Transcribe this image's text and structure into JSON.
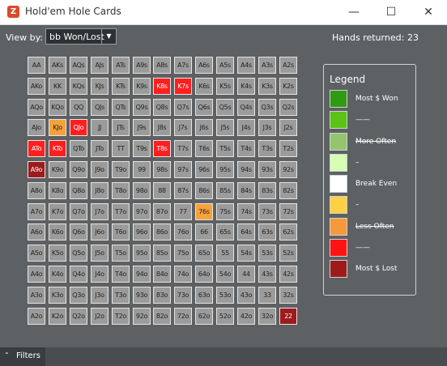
{
  "window": {
    "title": "Hold'em Hole Cards",
    "minimize_glyph": "—",
    "maximize_glyph": "☐",
    "close_glyph": "✕",
    "app_icon": "Z"
  },
  "toolbar": {
    "view_by_label": "View by:",
    "view_by_value": "bb Won/Lost",
    "hands_returned_label": "Hands returned:",
    "hands_returned_value": "23"
  },
  "colors": {
    "neutral": "#9b9b9b",
    "lost_red": "#ff1f1f",
    "dark_red": "#9e1b1b",
    "orange": "#f5a23b"
  },
  "grid": {
    "rows": [
      [
        "AA",
        "AKs",
        "AQs",
        "AJs",
        "ATs",
        "A9s",
        "A8s",
        "A7s",
        "A6s",
        "A5s",
        "A4s",
        "A3s",
        "A2s"
      ],
      [
        "AKo",
        "KK",
        "KQs",
        "KJs",
        "KTs",
        "K9s",
        "K8s",
        "K7s",
        "K6s",
        "K5s",
        "K4s",
        "K3s",
        "K2s"
      ],
      [
        "AQo",
        "KQo",
        "QQ",
        "QJs",
        "QTs",
        "Q9s",
        "Q8s",
        "Q7s",
        "Q6s",
        "Q5s",
        "Q4s",
        "Q3s",
        "Q2s"
      ],
      [
        "AJo",
        "KJo",
        "QJo",
        "JJ",
        "JTs",
        "J9s",
        "J8s",
        "J7s",
        "J6s",
        "J5s",
        "J4s",
        "J3s",
        "J2s"
      ],
      [
        "ATo",
        "KTo",
        "QTo",
        "JTo",
        "TT",
        "T9s",
        "T8s",
        "T7s",
        "T6s",
        "T5s",
        "T4s",
        "T3s",
        "T2s"
      ],
      [
        "A9o",
        "K9o",
        "Q9o",
        "J9o",
        "T9o",
        "99",
        "98s",
        "97s",
        "96s",
        "95s",
        "94s",
        "93s",
        "92s"
      ],
      [
        "A8o",
        "K8o",
        "Q8o",
        "J8o",
        "T8o",
        "98o",
        "88",
        "87s",
        "86s",
        "85s",
        "84s",
        "83s",
        "82s"
      ],
      [
        "A7o",
        "K7o",
        "Q7o",
        "J7o",
        "T7o",
        "97o",
        "87o",
        "77",
        "76s",
        "75s",
        "74s",
        "73s",
        "72s"
      ],
      [
        "A6o",
        "K6o",
        "Q6o",
        "J6o",
        "T6o",
        "96o",
        "86o",
        "76o",
        "66",
        "65s",
        "64s",
        "63s",
        "62s"
      ],
      [
        "A5o",
        "K5o",
        "Q5o",
        "J5o",
        "T5o",
        "95o",
        "85o",
        "75o",
        "65o",
        "55",
        "54s",
        "53s",
        "52s"
      ],
      [
        "A4o",
        "K4o",
        "Q4o",
        "J4o",
        "T4o",
        "94o",
        "84o",
        "74o",
        "64o",
        "54o",
        "44",
        "43s",
        "42s"
      ],
      [
        "A3o",
        "K3o",
        "Q3o",
        "J3o",
        "T3o",
        "93o",
        "83o",
        "73o",
        "63o",
        "53o",
        "43o",
        "33",
        "32s"
      ],
      [
        "A2o",
        "K2o",
        "Q2o",
        "J2o",
        "T2o",
        "92o",
        "82o",
        "72o",
        "62o",
        "52o",
        "42o",
        "32o",
        "22"
      ]
    ],
    "highlights": {
      "K8s": "#ff1f1f",
      "K7s": "#ff1f1f",
      "KJo": "#f5a23b",
      "QJo": "#ff1f1f",
      "ATo": "#ff1f1f",
      "KTo": "#ff1f1f",
      "T8s": "#ff1f1f",
      "A9o": "#9e1b1b",
      "76s": "#f5a23b",
      "22": "#9e1b1b"
    },
    "highlight_text": {
      "#ff1f1f": "#ffffff",
      "#9e1b1b": "#ffffff",
      "#f5a23b": "#222222"
    }
  },
  "legend": {
    "title": "Legend",
    "items": [
      {
        "label": "Most $ Won",
        "color": "#2e9b12",
        "strike": false
      },
      {
        "label": "——",
        "color": "#59c416",
        "strike": false
      },
      {
        "label": "More Often",
        "color": "#95c46f",
        "strike": true
      },
      {
        "label": "–",
        "color": "#d6ffb3",
        "strike": false
      },
      {
        "label": "Break Even",
        "color": "#ffffff",
        "strike": false
      },
      {
        "label": "–",
        "color": "#ffd040",
        "strike": false
      },
      {
        "label": "Less Often",
        "color": "#f59a3a",
        "strike": true
      },
      {
        "label": "——",
        "color": "#ff1414",
        "strike": false
      },
      {
        "label": "Most $ Lost",
        "color": "#9e1b1b",
        "strike": false
      }
    ]
  },
  "footer": {
    "filters_label": "Filters",
    "filters_chevron": "⌃"
  }
}
